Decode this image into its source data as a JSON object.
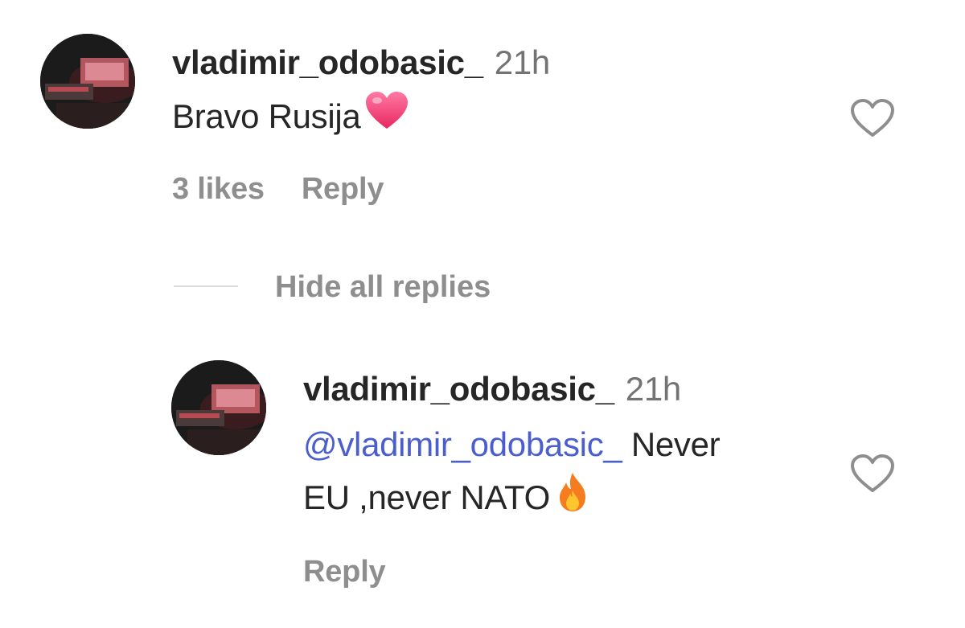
{
  "comment": {
    "username": "vladimir_odobasic_",
    "time": "21h",
    "text": "Bravo Rusija",
    "emoji": "pink-heart",
    "likes": "3 likes",
    "reply_label": "Reply"
  },
  "hide_replies_label": "Hide all replies",
  "reply": {
    "username": "vladimir_odobasic_",
    "time": "21h",
    "mention": "@vladimir_odobasic_",
    "text_line1": " Never",
    "text_line2": "EU ,never NATO",
    "emoji": "fire",
    "reply_label": "Reply"
  },
  "colors": {
    "text": "#262626",
    "secondary": "#737373",
    "meta": "#8e8e8e",
    "mention": "#4a5ecf",
    "heart_emoji": "#f0457a",
    "fire_emoji": "#f57c1f"
  }
}
